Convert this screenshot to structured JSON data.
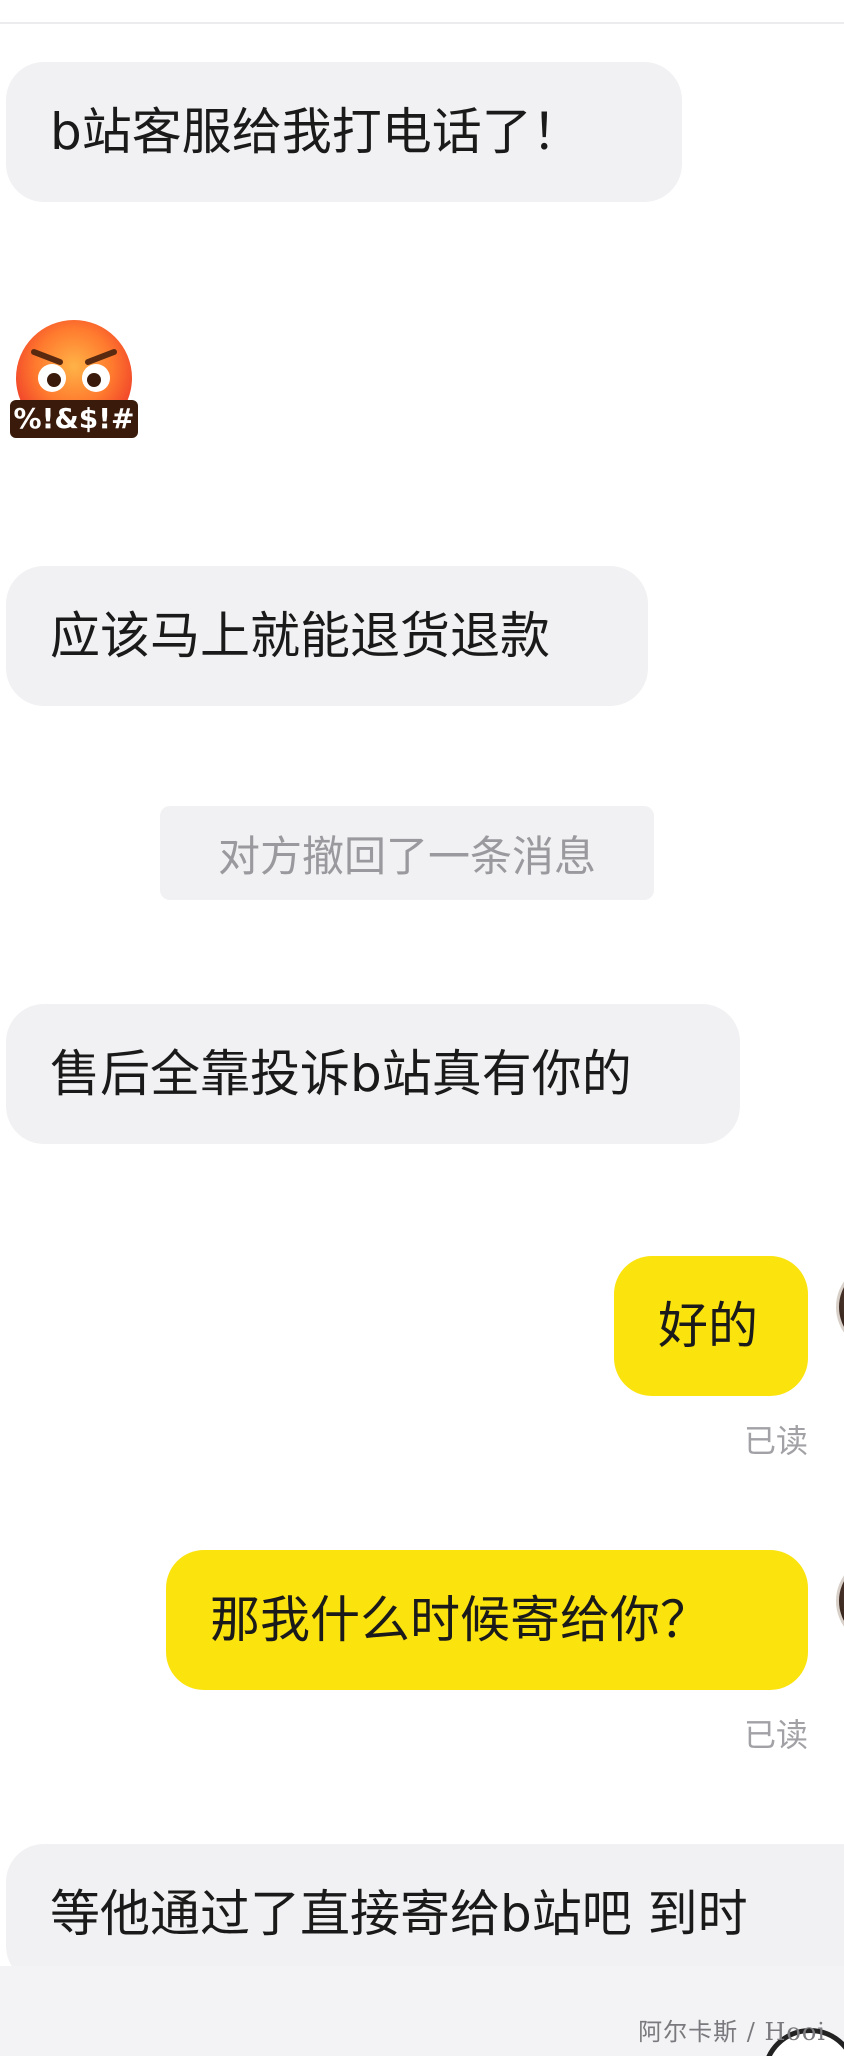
{
  "messages": [
    {
      "text": "b站客服给我打电话了！"
    },
    {
      "text": "应该马上就能退货退款"
    },
    {
      "text": "售后全靠投诉b站真有你的"
    },
    {
      "text": "好的"
    },
    {
      "text": "那我什么时候寄给你？"
    },
    {
      "text": "等他通过了直接寄给b站吧 到时"
    }
  ],
  "sticker": {
    "icon": "swearing-face-emoji",
    "text": "%!&$!#"
  },
  "system": {
    "recall_notice": "对方撤回了一条消息"
  },
  "status": {
    "read_1": "已读",
    "read_2": "已读"
  },
  "watermark": "阿尔卡斯 / Hooi",
  "colors": {
    "incoming": "#f1f1f3",
    "outgoing": "#fbe30e",
    "notice_text": "#9a9a9e"
  }
}
